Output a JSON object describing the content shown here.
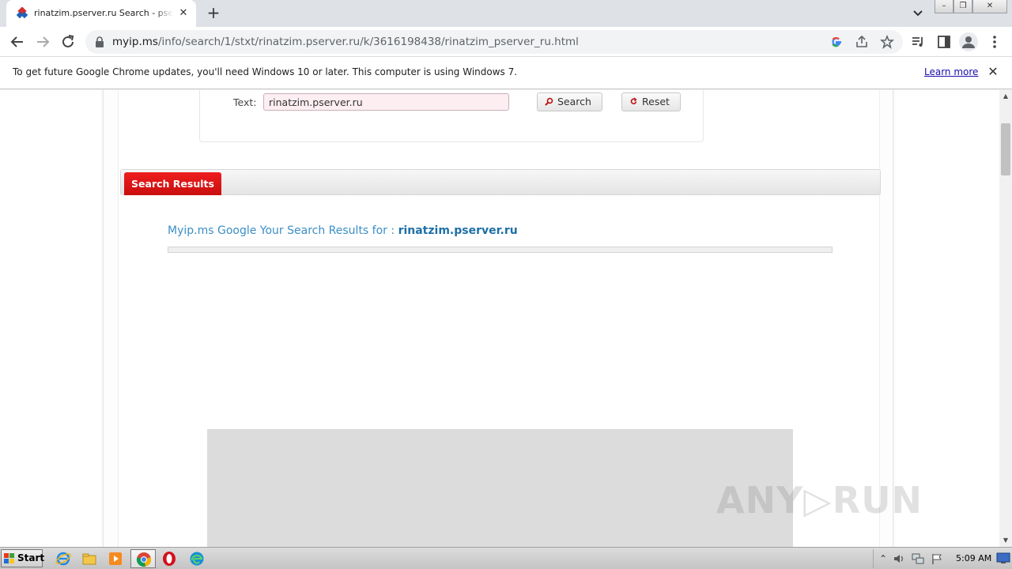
{
  "browser": {
    "tab": {
      "title": "rinatzim.pserver.ru Search - pserver.ru",
      "favicon": "myip-ms-favicon",
      "close_glyph": "✕"
    },
    "new_tab_glyph": "+",
    "window_buttons": [
      "–",
      "❐",
      "✕"
    ],
    "address": {
      "host": "myip.ms",
      "path": "/info/search/1/stxt/rinatzim.pserver.ru/k/3616198438/rinatzim_pserver_ru.html"
    },
    "icons": [
      "back-icon",
      "forward-icon",
      "reload-icon",
      "lock-icon",
      "google-icon",
      "share-icon",
      "bookmark-star-icon",
      "media-controls-icon",
      "side-panel-icon",
      "profile-icon",
      "menu-dots-icon"
    ]
  },
  "infobar": {
    "message": "To get future Google Chrome updates, you'll need Windows 10 or later. This computer is using Windows 7.",
    "link": "Learn more",
    "close_glyph": "✕"
  },
  "search_form": {
    "text_label": "Text:",
    "text_value": "rinatzim.pserver.ru",
    "search_button": "Search",
    "reset_button": "Reset"
  },
  "results": {
    "tab_label": "Search Results",
    "heading_prefix": "Myip.ms Google Your Search Results for :",
    "heading_query": "rinatzim.pserver.ru"
  },
  "watermark": "ANY▷RUN",
  "scrollbar": {
    "up_glyph": "▲",
    "down_glyph": "▼"
  },
  "taskbar": {
    "start_label": "Start",
    "apps": [
      "internet-explorer-icon",
      "file-explorer-icon",
      "media-player-icon",
      "chrome-icon",
      "opera-icon",
      "edge-icon"
    ],
    "tray_expand_glyph": "⌃",
    "clock": "5:09 AM"
  },
  "colors": {
    "accent_red": "#d81414",
    "link_blue": "#1a0dab",
    "heading_blue": "#3b8fc6"
  }
}
